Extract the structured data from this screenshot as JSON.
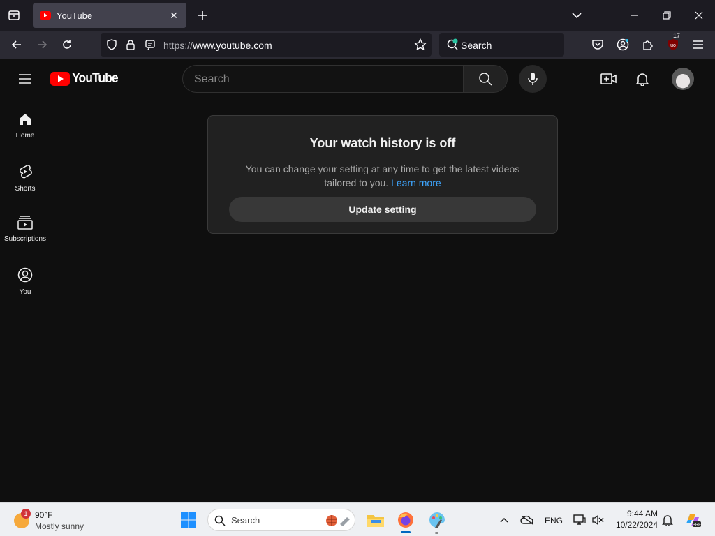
{
  "browser": {
    "tab": {
      "title": "YouTube"
    },
    "url": {
      "protocol": "https://",
      "host": "www.youtube.com"
    },
    "search_placeholder": "Search",
    "extension_badge": "17"
  },
  "youtube": {
    "logo_text": "YouTube",
    "search_placeholder": "Search",
    "sidebar": [
      {
        "label": "Home",
        "icon": "home-icon"
      },
      {
        "label": "Shorts",
        "icon": "shorts-icon"
      },
      {
        "label": "Subscriptions",
        "icon": "subscriptions-icon"
      },
      {
        "label": "You",
        "icon": "you-icon"
      }
    ],
    "history_card": {
      "heading": "Your watch history is off",
      "body": "You can change your setting at any time to get the latest videos tailored to you.",
      "link": "Learn more",
      "button": "Update setting"
    }
  },
  "taskbar": {
    "weather": {
      "temp": "90°F",
      "condition": "Mostly sunny",
      "badge": "1"
    },
    "search_placeholder": "Search",
    "language": "ENG",
    "time": "9:44 AM",
    "date": "10/22/2024"
  },
  "colors": {
    "yt_red": "#ff0000",
    "link_blue": "#3ea6ff",
    "background": "#0f0f0f"
  }
}
